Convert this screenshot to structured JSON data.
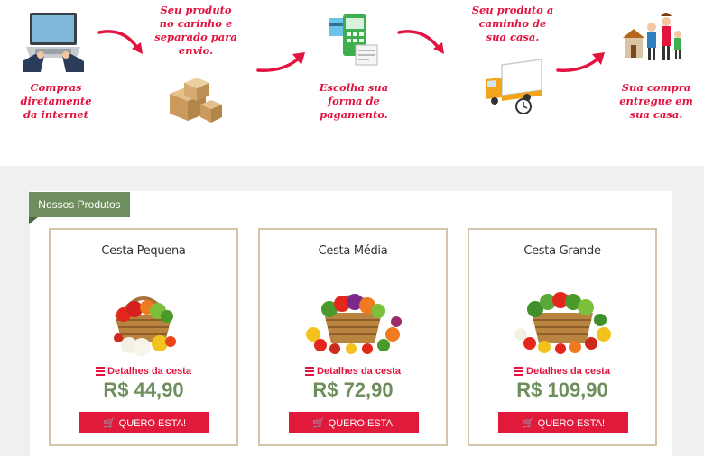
{
  "steps": [
    {
      "text": "Compras\ndiretamente\nda internet",
      "icon": "laptop-hands-icon"
    },
    {
      "text": "Seu produto\nno carinho e\nseparado para\nenvio.",
      "icon": "boxes-icon"
    },
    {
      "text": "Escolha sua\nforma de\npagamento.",
      "icon": "payment-terminal-icon"
    },
    {
      "text": "Seu produto a\ncaminho de\nsua casa.",
      "icon": "delivery-truck-icon"
    },
    {
      "text": "Sua compra\nentregue em\nsua casa.",
      "icon": "family-house-icon"
    }
  ],
  "section": {
    "tab_label": "Nossos Produtos"
  },
  "products": [
    {
      "title": "Cesta Pequena",
      "details_label": "Detalhes da cesta",
      "price": "R$ 44,90",
      "button_label": "QUERO ESTA!"
    },
    {
      "title": "Cesta Média",
      "details_label": "Detalhes da cesta",
      "price": "R$ 72,90",
      "button_label": "QUERO ESTA!"
    },
    {
      "title": "Cesta Grande",
      "details_label": "Detalhes da cesta",
      "price": "R$ 109,90",
      "button_label": "QUERO ESTA!"
    }
  ],
  "colors": {
    "accent_red": "#e3133f",
    "price_green": "#6e8f5d",
    "tab_green": "#6e8f5d",
    "card_border": "#d5c4ad"
  }
}
